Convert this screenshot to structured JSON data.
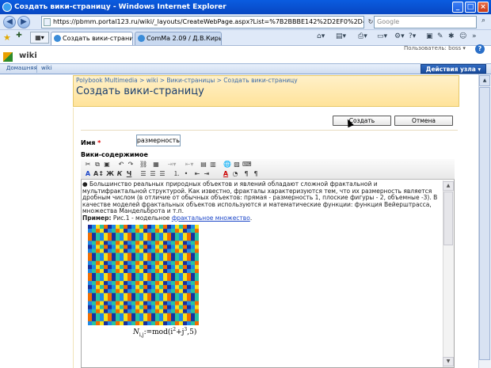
{
  "window": {
    "title": "Создать вики-страницу - Windows Internet Explorer",
    "buttons": [
      "_",
      "□",
      "×"
    ]
  },
  "address": {
    "url": "https://pbmm.portal123.ru/wiki/_layouts/CreateWebPage.aspx?List=%7B2BBBE142%2D2EF0%2D4154%2DBFBD%2DB7",
    "search_placeholder": "Google"
  },
  "tabs": [
    {
      "label": "Создать вики-страницу",
      "active": true
    },
    {
      "label": "ComMa 2.09 / Д.В.Кирьяно...",
      "active": false
    }
  ],
  "sp": {
    "site": "wiki",
    "user": "Пользователь: boss ▾",
    "nav": [
      "Домашняя",
      "wiki"
    ],
    "site_actions": "Действия узла ▾"
  },
  "page": {
    "breadcrumb": "Polybook Multimedia > wiki > Вики-страницы > Создать вики-страницу",
    "title": "Создать вики-страницу"
  },
  "form": {
    "create": "Создать",
    "cancel": "Отмена",
    "name_label": "Имя",
    "required": "*",
    "name_value": "Фрактальная размерность",
    "content_label": "Вики-содержимое"
  },
  "editor": {
    "bullet": "●",
    "text": "Большинство реальных природных объектов и явлений обладают сложной фрактальной и мультифрактальной структурой. Как известно, фракталы характеризуются тем, что их размерность является дробным числом (в отличие от обычных объектов: прямая - размерность 1, плоские фигуры - 2, объемные -3). В качестве моделей фрактальных объектов используются и математические функции: функция Вейерштрасса, множества Мандельброта и т.п.",
    "example_label": "Пример:",
    "example_text": "Рис.1 - модельное",
    "example_link": "фрактальное множество",
    "example_end": ".",
    "formula": "N_{i,j} := mod(i² + j³, 5)",
    "f_n": "N",
    "f_sub": "i,j",
    "f_rest": ":=mod(i",
    "f_sup2": "2",
    "f_plus": "+j",
    "f_sup3": "3",
    "f_end": ",5)"
  },
  "colors": {
    "title_bar": "#0847c2",
    "sp_header": "#ffe39a",
    "accent": "#1a3e6e"
  }
}
